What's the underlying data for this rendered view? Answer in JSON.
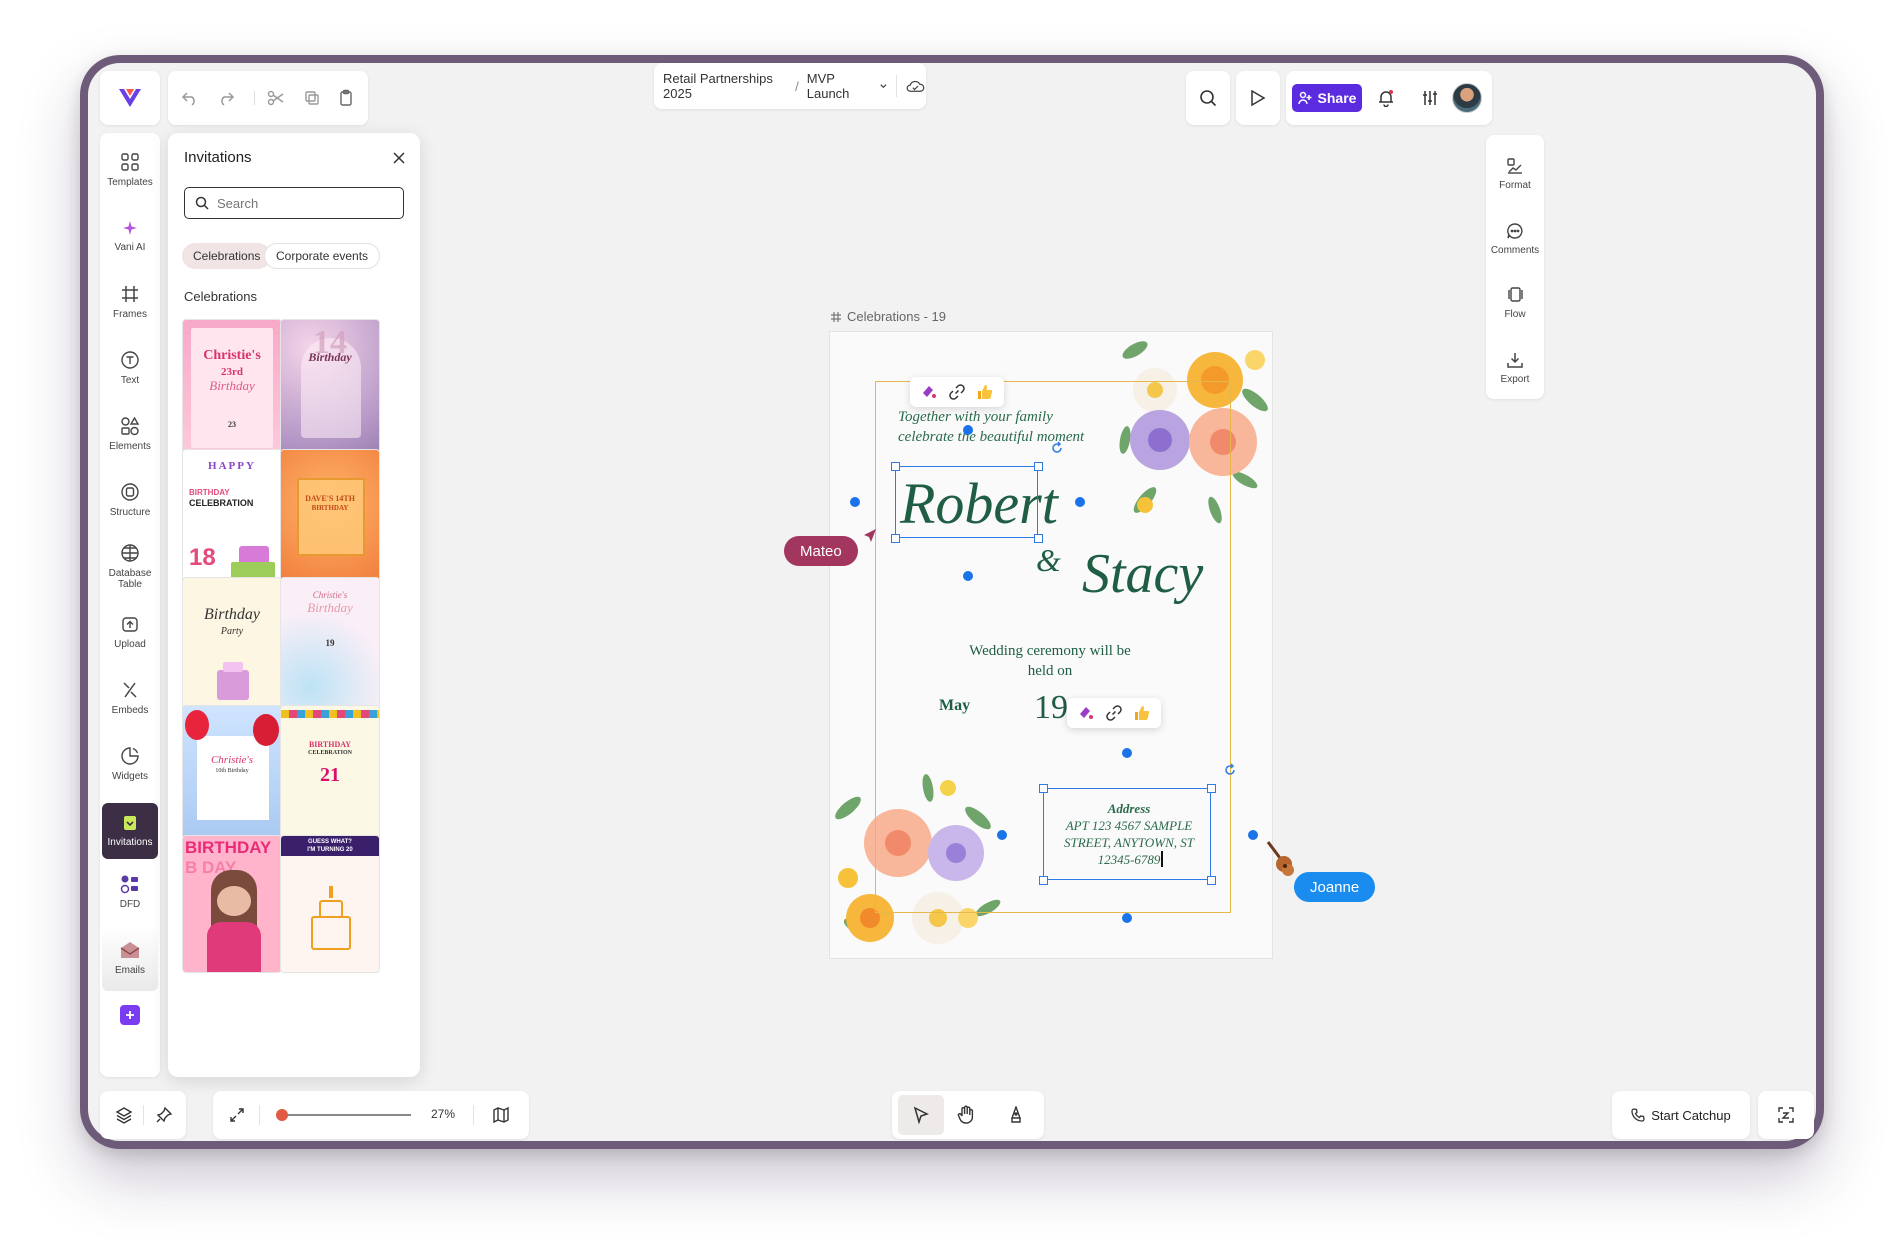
{
  "toolbar": {
    "undo": "undo-icon",
    "redo": "redo-icon",
    "cut": "scissors-icon",
    "copy": "copy-icon",
    "paste": "clipboard-icon"
  },
  "breadcrumb": {
    "project": "Retail Partnerships 2025",
    "separator": "/",
    "page": "MVP Launch"
  },
  "topright": {
    "share_label": "Share"
  },
  "rail": {
    "items": [
      {
        "label": "Templates"
      },
      {
        "label": "Vani AI"
      },
      {
        "label": "Frames"
      },
      {
        "label": "Text"
      },
      {
        "label": "Elements"
      },
      {
        "label": "Structure"
      },
      {
        "label": "Database Table"
      },
      {
        "label": "Upload"
      },
      {
        "label": "Embeds"
      },
      {
        "label": "Widgets"
      },
      {
        "label": "Invitations"
      },
      {
        "label": "DFD"
      },
      {
        "label": "Emails"
      }
    ]
  },
  "panel": {
    "title": "Invitations",
    "search_placeholder": "Search",
    "chips": [
      "Celebrations",
      "Corporate events"
    ],
    "section_title": "Celebrations",
    "thumbs": [
      {
        "title": "Christie's",
        "sub": "23rd",
        "sub2": "Birthday",
        "num": "23"
      },
      {
        "title": "Birthday",
        "num": "14"
      },
      {
        "title": "HAPPY",
        "sub": "BIRTHDAY",
        "sub2": "CELEBRATION",
        "num": "18"
      },
      {
        "title": "DAVE'S 14TH",
        "sub": "BIRTHDAY"
      },
      {
        "title": "Birthday",
        "sub": "Party"
      },
      {
        "title": "Christie's",
        "sub": "Birthday",
        "num": "19"
      },
      {
        "title": "Christie's",
        "sub": "10th Birthday"
      },
      {
        "title": "BIRTHDAY",
        "sub": "CELEBRATION",
        "num": "21"
      },
      {
        "title": "BIRTHDAY"
      },
      {
        "title": "GUESS WHAT?",
        "sub": "I'M TURNING 20"
      }
    ]
  },
  "right_rail": {
    "items": [
      {
        "label": "Format"
      },
      {
        "label": "Comments"
      },
      {
        "label": "Flow"
      },
      {
        "label": "Export"
      }
    ]
  },
  "canvas": {
    "frame_label": "Celebrations - 19",
    "line1": "Together with your family",
    "line2": "celebrate the beautiful moment",
    "name1": "Robert",
    "amp": "&",
    "name2": "Stacy",
    "ceremony1": "Wedding ceremony will be",
    "ceremony2": "held on",
    "month": "May",
    "day": "19",
    "address_title": "Address",
    "address1": "APT 123 4567 SAMPLE",
    "address2": "STREET, ANYTOWN, ST",
    "address3": "12345-6789",
    "collaborators": [
      {
        "name": "Mateo",
        "color": "#a3365f"
      },
      {
        "name": "Joanne",
        "color": "#1a8cf0"
      }
    ]
  },
  "bottom": {
    "zoom": "27%",
    "zoom_fraction": 0.0,
    "catchup": "Start Catchup"
  },
  "colors": {
    "accent": "#5b2be0",
    "selection": "#2f7be5",
    "frame_gold": "#e6b84a",
    "script_green": "#1f5e44"
  }
}
